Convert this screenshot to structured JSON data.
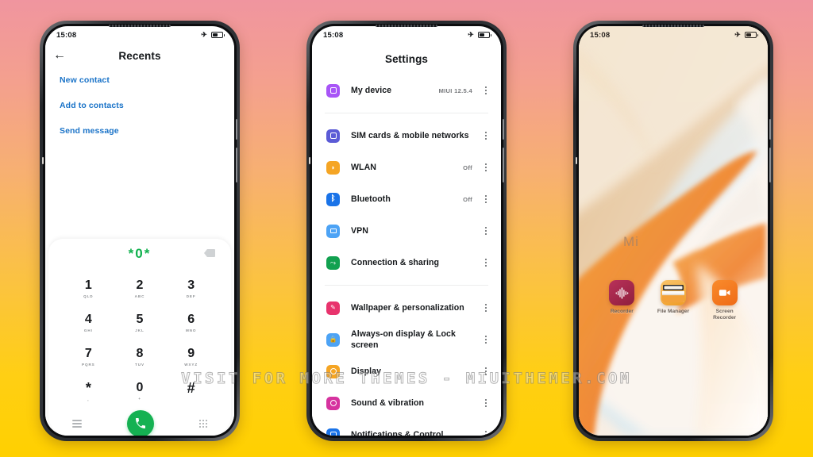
{
  "watermark": "VISIT FOR MORE THEMES - MIUITHEMER.COM",
  "status_bar": {
    "time": "15:08",
    "airplane_icon": "airplane-mode-icon",
    "battery_icon": "battery-icon"
  },
  "phone1": {
    "screen_name": "recents-dialer",
    "header": {
      "back_icon": "back-arrow-icon",
      "title": "Recents"
    },
    "links": [
      {
        "label": "New contact"
      },
      {
        "label": "Add to contacts"
      },
      {
        "label": "Send message"
      }
    ],
    "dialer": {
      "entered_number": "*0*",
      "backspace_icon": "backspace-icon",
      "keys": [
        {
          "digit": "1",
          "letters": "QLD"
        },
        {
          "digit": "2",
          "letters": "ABC"
        },
        {
          "digit": "3",
          "letters": "DEF"
        },
        {
          "digit": "4",
          "letters": "GHI"
        },
        {
          "digit": "5",
          "letters": "JKL"
        },
        {
          "digit": "6",
          "letters": "MNO"
        },
        {
          "digit": "7",
          "letters": "PQRS"
        },
        {
          "digit": "8",
          "letters": "TUV"
        },
        {
          "digit": "9",
          "letters": "WXYZ"
        },
        {
          "digit": "*",
          "letters": ","
        },
        {
          "digit": "0",
          "letters": "+"
        },
        {
          "digit": "#",
          "letters": ""
        }
      ],
      "menu_icon": "hamburger-menu-icon",
      "call_icon": "phone-call-icon",
      "keypad_icon": "keypad-dots-icon",
      "call_button_color": "#15b152",
      "number_color": "#11b14e"
    }
  },
  "phone2": {
    "screen_name": "settings",
    "title": "Settings",
    "groups": [
      {
        "items": [
          {
            "label": "My device",
            "value": "MIUI 12.5.4",
            "icon": "device-icon",
            "color": "#a855f7"
          }
        ]
      },
      {
        "items": [
          {
            "label": "SIM cards & mobile networks",
            "value": "",
            "icon": "sim-card-icon",
            "color": "#5b5bd6"
          },
          {
            "label": "WLAN",
            "value": "Off",
            "icon": "wifi-icon",
            "color": "#f5a524"
          },
          {
            "label": "Bluetooth",
            "value": "Off",
            "icon": "bluetooth-icon",
            "color": "#1a73e8"
          },
          {
            "label": "VPN",
            "value": "",
            "icon": "vpn-icon",
            "color": "#4da3f5"
          },
          {
            "label": "Connection & sharing",
            "value": "",
            "icon": "share-icon",
            "color": "#12a150"
          }
        ]
      },
      {
        "items": [
          {
            "label": "Wallpaper & personalization",
            "value": "",
            "icon": "wallpaper-brush-icon",
            "color": "#e8336d"
          },
          {
            "label": "Always-on display & Lock screen",
            "value": "",
            "icon": "lock-icon",
            "color": "#4da3f5"
          },
          {
            "label": "Display",
            "value": "",
            "icon": "brightness-icon",
            "color": "#f5a524"
          },
          {
            "label": "Sound & vibration",
            "value": "",
            "icon": "sound-icon",
            "color": "#d6339f"
          },
          {
            "label": "Notifications & Control",
            "value": "",
            "icon": "notifications-icon",
            "color": "#1a73e8"
          }
        ]
      }
    ],
    "kebab_icon": "more-options-icon"
  },
  "phone3": {
    "screen_name": "home-screen",
    "widget_text": "Mi",
    "apps": [
      {
        "label": "Recorder",
        "icon": "voice-recorder-icon",
        "color": "#a8284a"
      },
      {
        "label": "File Manager",
        "icon": "file-manager-icon",
        "color": "#f0a02e"
      },
      {
        "label": "Screen Recorder",
        "icon": "screen-recorder-icon",
        "color": "#f2711c"
      }
    ]
  }
}
